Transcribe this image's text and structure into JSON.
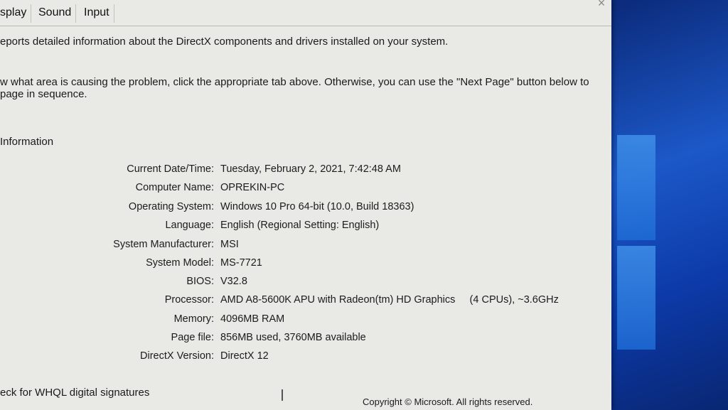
{
  "tabs": [
    {
      "label": "splay"
    },
    {
      "label": "Sound"
    },
    {
      "label": "Input"
    }
  ],
  "intro": {
    "line1": "eports detailed information about the DirectX components and drivers installed on your system.",
    "line2": "w what area is causing the problem, click the appropriate tab above.  Otherwise, you can use the \"Next Page\" button below to",
    "line3": "page in sequence."
  },
  "system_info": {
    "title": "Information",
    "rows": [
      {
        "label": "Current Date/Time:",
        "value": "Tuesday, February 2, 2021, 7:42:48 AM"
      },
      {
        "label": "Computer Name:",
        "value": "OPREKIN-PC"
      },
      {
        "label": "Operating System:",
        "value": "Windows 10 Pro 64-bit (10.0, Build 18363)"
      },
      {
        "label": "Language:",
        "value": "English (Regional Setting: English)"
      },
      {
        "label": "System Manufacturer:",
        "value": "MSI"
      },
      {
        "label": "System Model:",
        "value": "MS-7721"
      },
      {
        "label": "BIOS:",
        "value": "V32.8"
      },
      {
        "label": "Processor:",
        "value": "AMD A8-5600K APU with Radeon(tm) HD Graphics     (4 CPUs), ~3.6GHz"
      },
      {
        "label": "Memory:",
        "value": "4096MB RAM"
      },
      {
        "label": "Page file:",
        "value": "856MB used, 3760MB available"
      },
      {
        "label": "DirectX Version:",
        "value": "DirectX 12"
      }
    ]
  },
  "whql_checkbox_label": "eck for WHQL digital signatures",
  "footer_copyright": "Copyright © Microsoft. All rights reserved.",
  "close_glyph": "×"
}
